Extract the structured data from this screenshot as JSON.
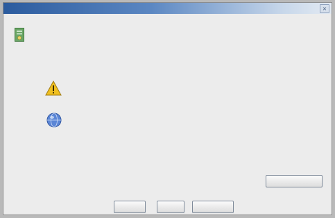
{
  "window": {
    "title": "",
    "close_glyph": "×"
  },
  "dialog": {
    "question": "",
    "publisher_line": "",
    "warning_text": "",
    "info_text": "",
    "body_text": ""
  },
  "icons": {
    "certificate": "certificate-icon",
    "warning": "warning-icon",
    "info": "info-globe-icon"
  },
  "buttons": {
    "more_info": "",
    "yes": "",
    "no": "",
    "cancel": ""
  },
  "colors": {
    "titlebar": "#2b5b9e",
    "warning": "#f0c020",
    "info": "#3f6fc4",
    "certificate": "#5f9b5a"
  }
}
